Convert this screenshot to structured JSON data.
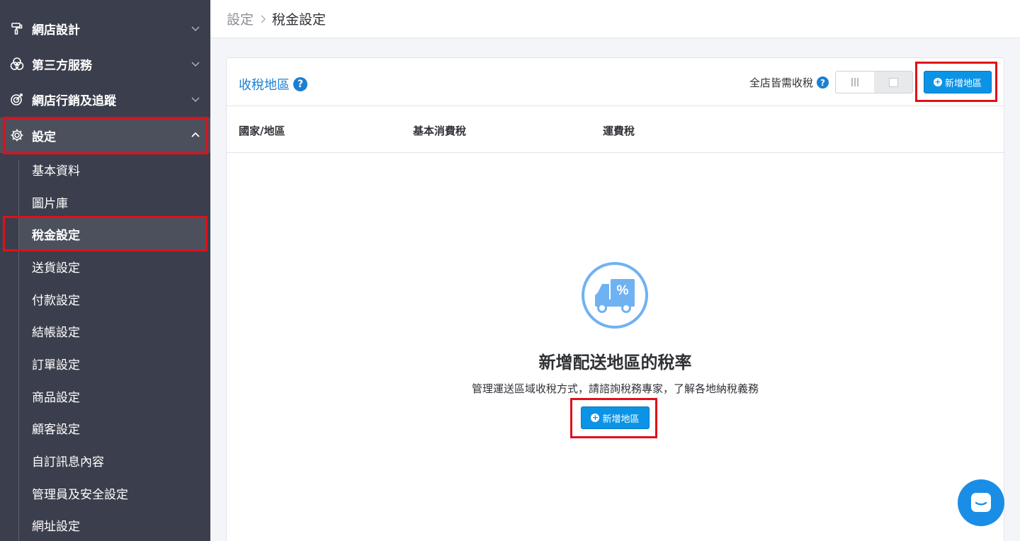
{
  "sidebar": {
    "items": [
      {
        "label": "網店設計",
        "icon": "paint-roller-icon"
      },
      {
        "label": "第三方服務",
        "icon": "venn-circles-icon"
      },
      {
        "label": "網店行銷及追蹤",
        "icon": "target-icon"
      },
      {
        "label": "設定",
        "icon": "gear-icon"
      }
    ],
    "sub_items": [
      {
        "label": "基本資料"
      },
      {
        "label": "圖片庫"
      },
      {
        "label": "稅金設定"
      },
      {
        "label": "送貨設定"
      },
      {
        "label": "付款設定"
      },
      {
        "label": "結帳設定"
      },
      {
        "label": "訂單設定"
      },
      {
        "label": "商品設定"
      },
      {
        "label": "顧客設定"
      },
      {
        "label": "自訂訊息內容"
      },
      {
        "label": "管理員及安全設定"
      },
      {
        "label": "網址設定"
      }
    ]
  },
  "breadcrumb": {
    "parent": "設定",
    "current": "稅金設定"
  },
  "card": {
    "title": "收稅地區",
    "tax_toggle_label": "全店皆需收稅",
    "add_button_label": "新增地區",
    "columns": [
      "國家/地區",
      "基本消費稅",
      "運費稅"
    ]
  },
  "empty_state": {
    "icon": "truck-percent-icon",
    "title": "新增配送地區的稅率",
    "description": "管理運送區域收稅方式，請諮詢稅務專家，了解各地納稅義務",
    "button_label": "新增地區"
  },
  "colors": {
    "primary": "#0b94e6",
    "sidebar": "#3b3f4d",
    "highlight": "#e0101a"
  }
}
